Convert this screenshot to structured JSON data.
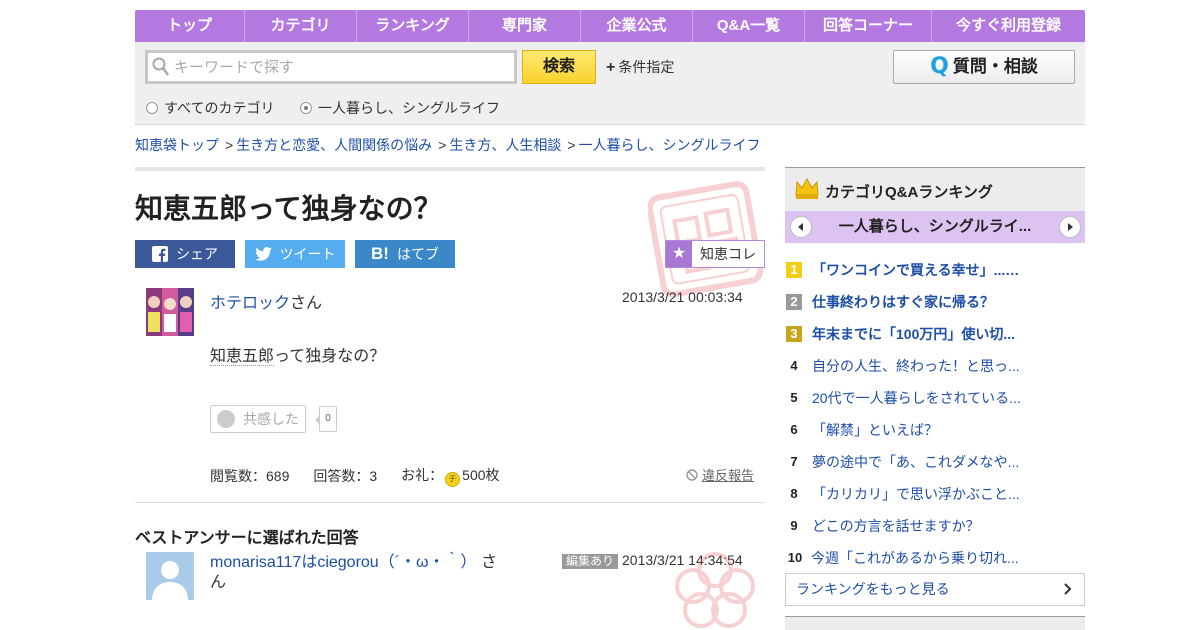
{
  "nav": {
    "items": [
      "トップ",
      "カテゴリ",
      "ランキング",
      "専門家",
      "企業公式",
      "Q&A一覧",
      "回答コーナー",
      "今すぐ利用登録"
    ]
  },
  "search": {
    "placeholder": "キーワードで探す",
    "button_label": "検索",
    "condition_label": "条件指定",
    "ask_label": "質問・相談",
    "scope_all": "すべてのカテゴリ",
    "scope_current": "一人暮らし、シングルライフ"
  },
  "breadcrumb": [
    "知恵袋トップ",
    "生き方と恋愛、人間関係の悩み",
    "生き方、人生相談",
    "一人暮らし、シングルライフ"
  ],
  "question": {
    "title": "知恵五郎って独身なの？",
    "share_facebook": "シェア",
    "share_twitter": "ツイート",
    "share_hatena": "はてブ",
    "chie_kore": "知恵コレ",
    "user_name": "ホテロック",
    "user_suffix": "さん",
    "date": "2013/3/21  00:03:34",
    "body_keyword": "知恵五郎",
    "body_rest": "って独身なの？",
    "empathy_label": "共感した",
    "empathy_count": "0",
    "views": "閲覧数：689",
    "answers": "回答数：3",
    "reward_label": "お礼：",
    "reward_value": "500枚",
    "report_label": "違反報告"
  },
  "best_answer": {
    "heading": "ベストアンサーに選ばれた回答",
    "user_name": "monarisa117はciegorou（´・ω・｀）",
    "user_suffix": "さん",
    "edited_badge": "編集あり",
    "date": "2013/3/21  14:34:54"
  },
  "sidebar": {
    "ranking_title": "カテゴリQ&Aランキング",
    "category_label": "一人暮らし、シングルライ...",
    "ranking": [
      {
        "rank": "1",
        "text": "「ワンコインで買える幸せ」...…"
      },
      {
        "rank": "2",
        "text": "仕事終わりはすぐ家に帰る？"
      },
      {
        "rank": "3",
        "text": "年末までに「100万円」使い切..."
      },
      {
        "rank": "4",
        "text": "自分の人生、終わった！と思っ..."
      },
      {
        "rank": "5",
        "text": "20代で一人暮らしをされている..."
      },
      {
        "rank": "6",
        "text": "「解禁」といえば？"
      },
      {
        "rank": "7",
        "text": "夢の途中で「あ、これダメなや..."
      },
      {
        "rank": "8",
        "text": "「カリカリ」で思い浮かぶこと..."
      },
      {
        "rank": "9",
        "text": "どこの方言を話せますか？"
      },
      {
        "rank": "10",
        "text": "今週「これがあるから乗り切れ..."
      }
    ],
    "more_label": "ランキングをもっと見る"
  }
}
